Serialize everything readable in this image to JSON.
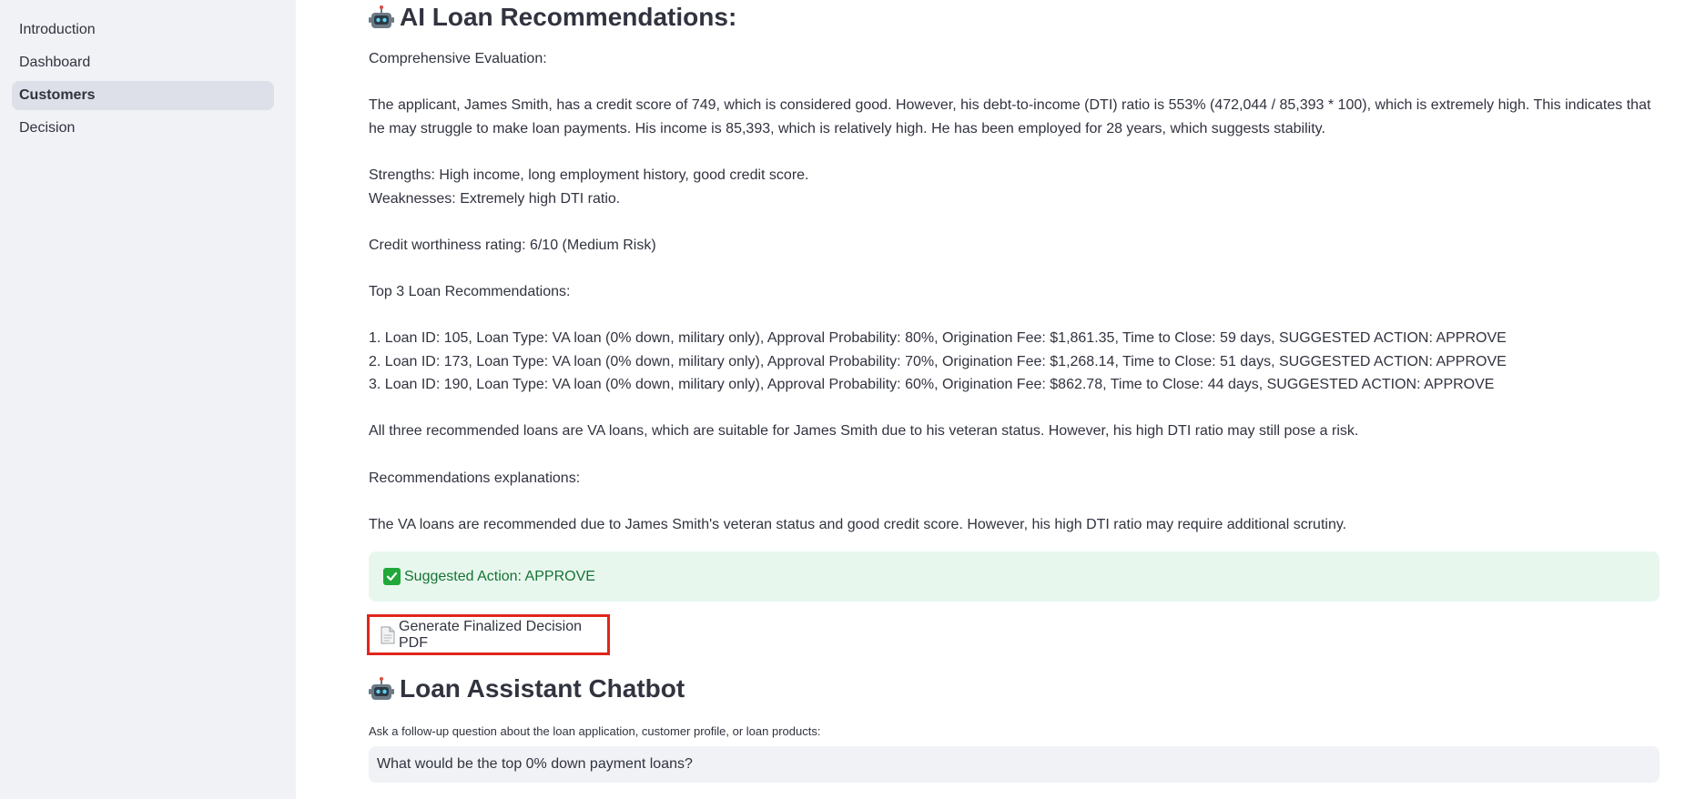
{
  "sidebar": {
    "items": [
      {
        "label": "Introduction"
      },
      {
        "label": "Dashboard"
      },
      {
        "label": "Customers"
      },
      {
        "label": "Decision"
      }
    ],
    "active": "Customers"
  },
  "recommendations": {
    "title": "AI Loan Recommendations:",
    "eval_heading": "Comprehensive Evaluation:",
    "eval_text": "The applicant, James Smith, has a credit score of 749, which is considered good. However, his debt-to-income (DTI) ratio is 553% (472,044 / 85,393 * 100), which is extremely high. This indicates that he may struggle to make loan payments. His income is 85,393, which is relatively high. He has been employed for 28 years, which suggests stability.",
    "strengths": "Strengths: High income, long employment history, good credit score.",
    "weaknesses": "Weaknesses: Extremely high DTI ratio.",
    "rating": "Credit worthiness rating: 6/10 (Medium Risk)",
    "top3_heading": "Top 3 Loan Recommendations:",
    "loans": [
      "1. Loan ID: 105, Loan Type: VA loan (0% down, military only), Approval Probability: 80%, Origination Fee: $1,861.35, Time to Close: 59 days, SUGGESTED ACTION: APPROVE",
      "2. Loan ID: 173, Loan Type: VA loan (0% down, military only), Approval Probability: 70%, Origination Fee: $1,268.14, Time to Close: 51 days, SUGGESTED ACTION: APPROVE",
      "3. Loan ID: 190, Loan Type: VA loan (0% down, military only), Approval Probability: 60%, Origination Fee: $862.78, Time to Close: 44 days, SUGGESTED ACTION: APPROVE"
    ],
    "summary": "All three recommended loans are VA loans, which are suitable for James Smith due to his veteran status. However, his high DTI ratio may still pose a risk.",
    "explanations_heading": "Recommendations explanations:",
    "explanations_text": "The VA loans are recommended due to James Smith's veteran status and good credit score. However, his high DTI ratio may require additional scrutiny.",
    "suggested_action": "Suggested Action: APPROVE",
    "pdf_button": "Generate Finalized Decision PDF"
  },
  "chatbot": {
    "title": "Loan Assistant Chatbot",
    "label": "Ask a follow-up question about the loan application, customer profile, or loan products:",
    "input_value": "What would be the top 0% down payment loans?"
  },
  "colors": {
    "sidebar_bg": "#f0f2f6",
    "active_item_bg": "#dde0e8",
    "success_bg": "#e7f7ee",
    "success_text": "#177233",
    "highlight_border": "#e0261c"
  },
  "icons": {
    "title_icon": "robot-icon",
    "success_icon": "check-mark-icon",
    "button_icon": "document-icon"
  }
}
